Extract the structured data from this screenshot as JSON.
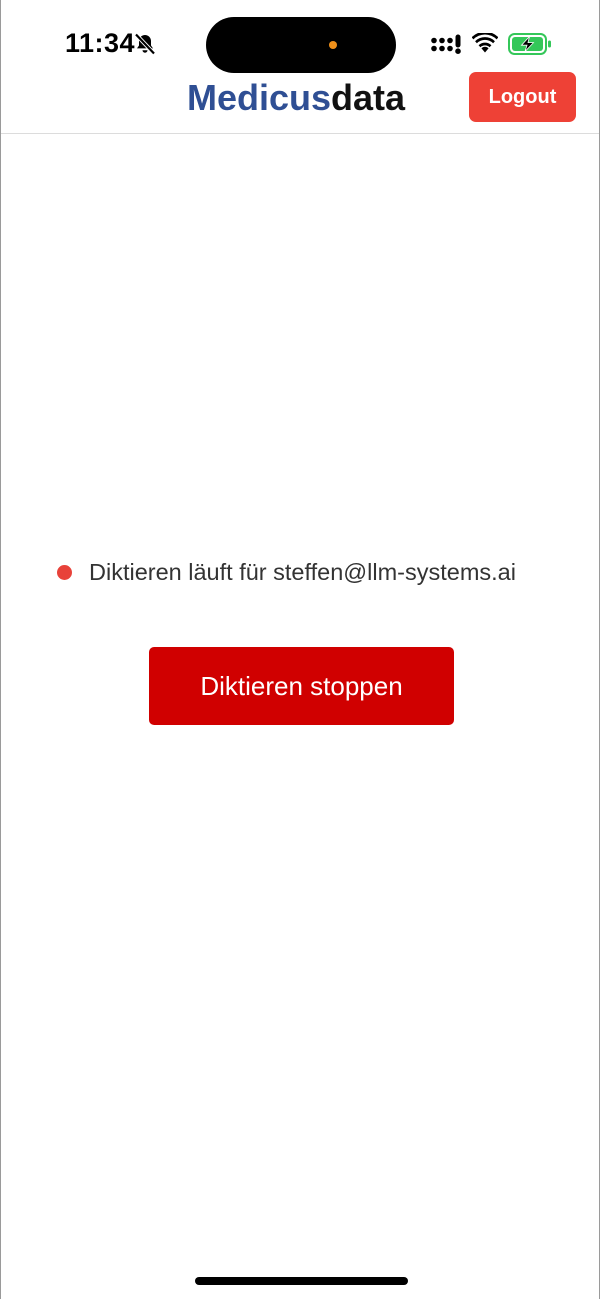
{
  "status_bar": {
    "time": "11:34",
    "icons": [
      "bell-muted-icon",
      "cellular-signal-icon",
      "wifi-icon",
      "battery-charging-icon"
    ]
  },
  "header": {
    "brand_part1": "Medicus",
    "brand_part2": "data",
    "logout_label": "Logout"
  },
  "main": {
    "status_text": "Diktieren läuft für steffen@llm-systems.ai",
    "stop_label": "Diktieren stoppen"
  },
  "colors": {
    "brand_blue": "#2f4f94",
    "logout_red": "#ee4136",
    "stop_red": "#d00000",
    "recording_dot": "#e8423a",
    "battery_green": "#34c759"
  }
}
